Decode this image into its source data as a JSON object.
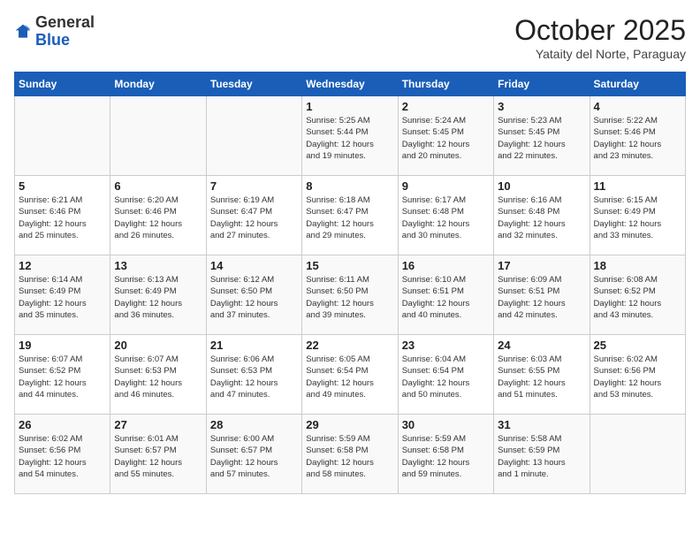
{
  "header": {
    "logo_general": "General",
    "logo_blue": "Blue",
    "month_title": "October 2025",
    "location": "Yataity del Norte, Paraguay"
  },
  "weekdays": [
    "Sunday",
    "Monday",
    "Tuesday",
    "Wednesday",
    "Thursday",
    "Friday",
    "Saturday"
  ],
  "weeks": [
    [
      {
        "day": "",
        "info": ""
      },
      {
        "day": "",
        "info": ""
      },
      {
        "day": "",
        "info": ""
      },
      {
        "day": "1",
        "info": "Sunrise: 5:25 AM\nSunset: 5:44 PM\nDaylight: 12 hours\nand 19 minutes."
      },
      {
        "day": "2",
        "info": "Sunrise: 5:24 AM\nSunset: 5:45 PM\nDaylight: 12 hours\nand 20 minutes."
      },
      {
        "day": "3",
        "info": "Sunrise: 5:23 AM\nSunset: 5:45 PM\nDaylight: 12 hours\nand 22 minutes."
      },
      {
        "day": "4",
        "info": "Sunrise: 5:22 AM\nSunset: 5:46 PM\nDaylight: 12 hours\nand 23 minutes."
      }
    ],
    [
      {
        "day": "5",
        "info": "Sunrise: 6:21 AM\nSunset: 6:46 PM\nDaylight: 12 hours\nand 25 minutes."
      },
      {
        "day": "6",
        "info": "Sunrise: 6:20 AM\nSunset: 6:46 PM\nDaylight: 12 hours\nand 26 minutes."
      },
      {
        "day": "7",
        "info": "Sunrise: 6:19 AM\nSunset: 6:47 PM\nDaylight: 12 hours\nand 27 minutes."
      },
      {
        "day": "8",
        "info": "Sunrise: 6:18 AM\nSunset: 6:47 PM\nDaylight: 12 hours\nand 29 minutes."
      },
      {
        "day": "9",
        "info": "Sunrise: 6:17 AM\nSunset: 6:48 PM\nDaylight: 12 hours\nand 30 minutes."
      },
      {
        "day": "10",
        "info": "Sunrise: 6:16 AM\nSunset: 6:48 PM\nDaylight: 12 hours\nand 32 minutes."
      },
      {
        "day": "11",
        "info": "Sunrise: 6:15 AM\nSunset: 6:49 PM\nDaylight: 12 hours\nand 33 minutes."
      }
    ],
    [
      {
        "day": "12",
        "info": "Sunrise: 6:14 AM\nSunset: 6:49 PM\nDaylight: 12 hours\nand 35 minutes."
      },
      {
        "day": "13",
        "info": "Sunrise: 6:13 AM\nSunset: 6:49 PM\nDaylight: 12 hours\nand 36 minutes."
      },
      {
        "day": "14",
        "info": "Sunrise: 6:12 AM\nSunset: 6:50 PM\nDaylight: 12 hours\nand 37 minutes."
      },
      {
        "day": "15",
        "info": "Sunrise: 6:11 AM\nSunset: 6:50 PM\nDaylight: 12 hours\nand 39 minutes."
      },
      {
        "day": "16",
        "info": "Sunrise: 6:10 AM\nSunset: 6:51 PM\nDaylight: 12 hours\nand 40 minutes."
      },
      {
        "day": "17",
        "info": "Sunrise: 6:09 AM\nSunset: 6:51 PM\nDaylight: 12 hours\nand 42 minutes."
      },
      {
        "day": "18",
        "info": "Sunrise: 6:08 AM\nSunset: 6:52 PM\nDaylight: 12 hours\nand 43 minutes."
      }
    ],
    [
      {
        "day": "19",
        "info": "Sunrise: 6:07 AM\nSunset: 6:52 PM\nDaylight: 12 hours\nand 44 minutes."
      },
      {
        "day": "20",
        "info": "Sunrise: 6:07 AM\nSunset: 6:53 PM\nDaylight: 12 hours\nand 46 minutes."
      },
      {
        "day": "21",
        "info": "Sunrise: 6:06 AM\nSunset: 6:53 PM\nDaylight: 12 hours\nand 47 minutes."
      },
      {
        "day": "22",
        "info": "Sunrise: 6:05 AM\nSunset: 6:54 PM\nDaylight: 12 hours\nand 49 minutes."
      },
      {
        "day": "23",
        "info": "Sunrise: 6:04 AM\nSunset: 6:54 PM\nDaylight: 12 hours\nand 50 minutes."
      },
      {
        "day": "24",
        "info": "Sunrise: 6:03 AM\nSunset: 6:55 PM\nDaylight: 12 hours\nand 51 minutes."
      },
      {
        "day": "25",
        "info": "Sunrise: 6:02 AM\nSunset: 6:56 PM\nDaylight: 12 hours\nand 53 minutes."
      }
    ],
    [
      {
        "day": "26",
        "info": "Sunrise: 6:02 AM\nSunset: 6:56 PM\nDaylight: 12 hours\nand 54 minutes."
      },
      {
        "day": "27",
        "info": "Sunrise: 6:01 AM\nSunset: 6:57 PM\nDaylight: 12 hours\nand 55 minutes."
      },
      {
        "day": "28",
        "info": "Sunrise: 6:00 AM\nSunset: 6:57 PM\nDaylight: 12 hours\nand 57 minutes."
      },
      {
        "day": "29",
        "info": "Sunrise: 5:59 AM\nSunset: 6:58 PM\nDaylight: 12 hours\nand 58 minutes."
      },
      {
        "day": "30",
        "info": "Sunrise: 5:59 AM\nSunset: 6:58 PM\nDaylight: 12 hours\nand 59 minutes."
      },
      {
        "day": "31",
        "info": "Sunrise: 5:58 AM\nSunset: 6:59 PM\nDaylight: 13 hours\nand 1 minute."
      },
      {
        "day": "",
        "info": ""
      }
    ]
  ]
}
